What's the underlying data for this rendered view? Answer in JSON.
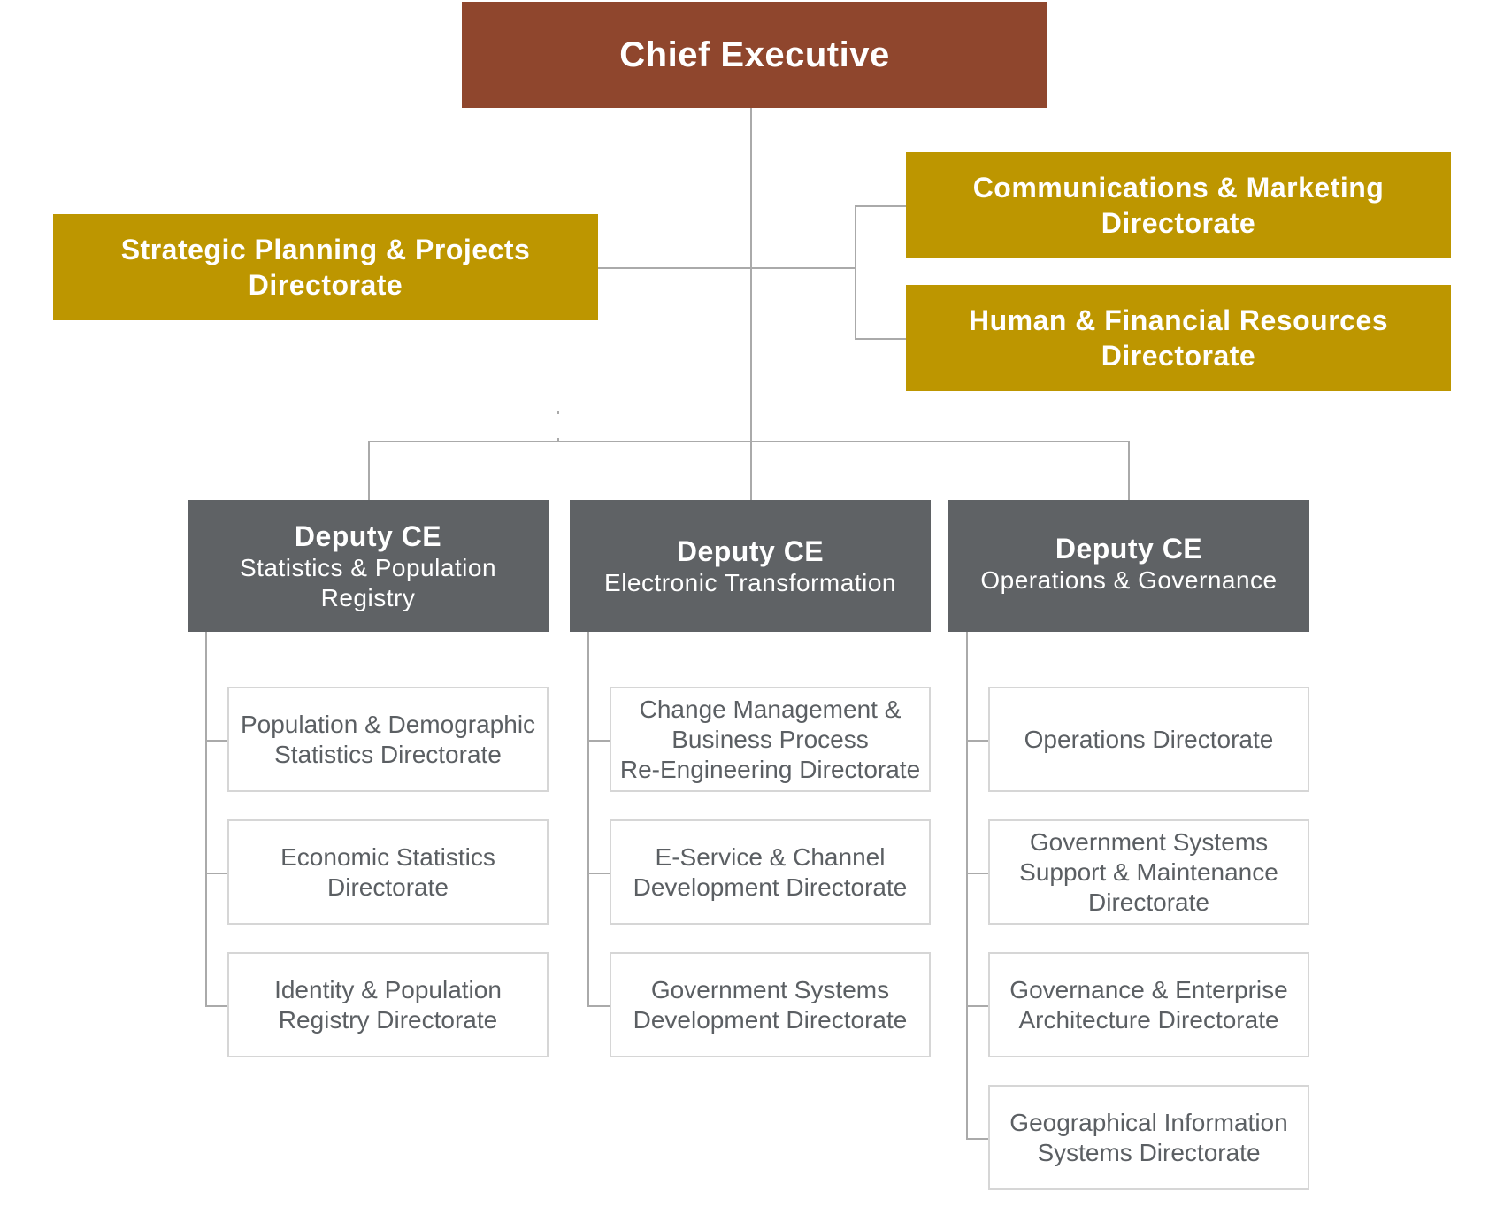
{
  "chief": {
    "label": "Chief Executive"
  },
  "staff": [
    {
      "label": "Strategic Planning & Projects\nDirectorate"
    },
    {
      "label": "Communications & Marketing\nDirectorate"
    },
    {
      "label": "Human & Financial Resources\nDirectorate"
    }
  ],
  "deputies": [
    {
      "title": "Deputy CE",
      "subtitle": "Statistics & Population\nRegistry",
      "children": [
        "Population & Demographic\nStatistics Directorate",
        "Economic Statistics\nDirectorate",
        "Identity & Population\nRegistry Directorate"
      ]
    },
    {
      "title": "Deputy CE",
      "subtitle": "Electronic Transformation",
      "children": [
        "Change Management &\nBusiness Process\nRe-Engineering Directorate",
        "E-Service & Channel\nDevelopment Directorate",
        "Government Systems\nDevelopment Directorate"
      ]
    },
    {
      "title": "Deputy CE",
      "subtitle": "Operations & Governance",
      "children": [
        "Operations Directorate",
        "Government Systems\nSupport  & Maintenance\nDirectorate",
        "Governance & Enterprise\nArchitecture Directorate",
        "Geographical Information\nSystems Directorate"
      ]
    }
  ],
  "colors": {
    "chief": "#8F462D",
    "staff": "#BD9600",
    "deputy": "#5F6265",
    "child_border": "#D6D6D6",
    "connector": "#AAAAAA"
  }
}
